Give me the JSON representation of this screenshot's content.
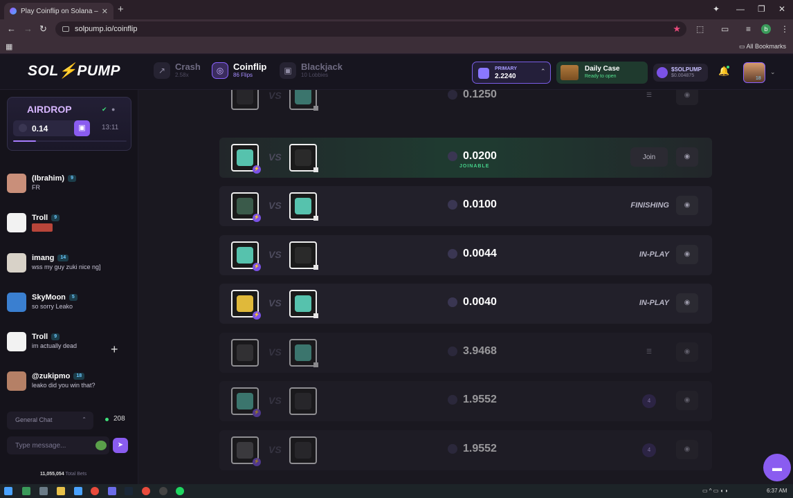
{
  "browser": {
    "tab_title": "Play Coinflip on Solana – No K",
    "tab_close": "✕",
    "new_tab": "+",
    "url": "solpump.io/coinflip",
    "bookmarks_label": "All Bookmarks",
    "profile_initial": "b",
    "window_controls": [
      "—",
      "❐",
      "✕"
    ]
  },
  "header": {
    "logo_part1": "SOL",
    "logo_bolt": "⚡",
    "logo_part2": "PUMP",
    "games": [
      {
        "label": "Crash",
        "sub": "2.58x",
        "icon": "chart-line-icon"
      },
      {
        "label": "Coinflip",
        "sub": "86 Flips",
        "icon": "coin-icon"
      },
      {
        "label": "Blackjack",
        "sub": "10 Lobbies",
        "icon": "cards-icon"
      }
    ],
    "wallet": {
      "label": "PRIMARY",
      "value": "2.2240"
    },
    "daily_case": {
      "label": "Daily Case",
      "sub": "Ready to open"
    },
    "token": {
      "label": "$SOLPUMP",
      "value": "$0.004875"
    },
    "user_level": "18"
  },
  "sidebar": {
    "airdrop": {
      "title": "AIRDROP",
      "amount": "0.14",
      "time": "13:11",
      "progress": 0.2
    },
    "messages": [
      {
        "name": "(Ibrahim)",
        "level": "9",
        "text": "FR",
        "avatar_color": "#c98f7a"
      },
      {
        "name": "Troll",
        "level": "9",
        "text": "",
        "avatar_color": "#f2f2f2"
      },
      {
        "name": "imang",
        "level": "14",
        "text": "wss my guy zuki nice ng]",
        "avatar_color": "#d8d2c8"
      },
      {
        "name": "SkyMoon",
        "level": "5",
        "text": "so sorry Leako",
        "avatar_color": "#3a7fd0"
      },
      {
        "name": "Troll",
        "level": "9",
        "text": "im actually dead",
        "avatar_color": "#f2f2f2"
      },
      {
        "name": "@zukipmo",
        "level": "18",
        "text": "leako did you win that?",
        "avatar_color": "#b58066"
      }
    ],
    "chat_room": "General Chat",
    "online_count": "208",
    "input_placeholder": "Type message...",
    "total_bets_value": "11,055,054",
    "total_bets_label": "Total Bets"
  },
  "flips": [
    {
      "amount": "0.1250",
      "status": "",
      "action": "menu",
      "dim": true
    },
    {
      "amount": "0.0200",
      "status": "JOINABLE",
      "action": "join",
      "join_label": "Join"
    },
    {
      "amount": "0.0100",
      "status": "FINISHING",
      "action": "status"
    },
    {
      "amount": "0.0044",
      "status": "IN-PLAY",
      "action": "status"
    },
    {
      "amount": "0.0040",
      "status": "IN-PLAY",
      "action": "status"
    },
    {
      "amount": "3.9468",
      "status": "",
      "action": "menu",
      "dim": true
    },
    {
      "amount": "1.9552",
      "status": "",
      "action": "count",
      "count": "4",
      "dim": true
    },
    {
      "amount": "1.9552",
      "status": "",
      "action": "count",
      "count": "4",
      "dim": true
    }
  ],
  "taskbar": {
    "time": "6:37 AM"
  },
  "colors": {
    "accent": "#8a5cf0",
    "joinable": "#45d28a",
    "bg": "#1a1820"
  }
}
